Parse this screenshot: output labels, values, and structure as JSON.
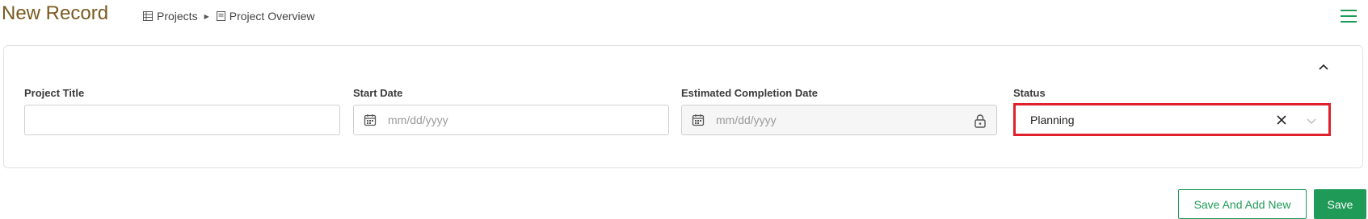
{
  "header": {
    "title": "New Record",
    "breadcrumb": [
      {
        "label": "Projects",
        "icon": "table-icon"
      },
      {
        "label": "Project Overview",
        "icon": "document-icon"
      }
    ],
    "menu_icon": "hamburger-menu-icon"
  },
  "form": {
    "collapse_icon": "chevron-up-icon",
    "fields": {
      "project_title": {
        "label": "Project Title",
        "value": "",
        "placeholder": ""
      },
      "start_date": {
        "label": "Start Date",
        "placeholder": "mm/dd/yyyy",
        "icon": "calendar-icon"
      },
      "estimated_completion": {
        "label": "Estimated Completion Date",
        "placeholder": "mm/dd/yyyy",
        "icon": "calendar-icon",
        "locked_icon": "lock-icon"
      },
      "status": {
        "label": "Status",
        "value": "Planning",
        "clear_icon": "close-icon",
        "dropdown_icon": "chevron-down-icon"
      }
    }
  },
  "actions": {
    "save_and_add_new": "Save And Add New",
    "save": "Save"
  },
  "colors": {
    "title": "#7a5a1f",
    "accent": "#1f9a57",
    "highlight": "#e0202a"
  }
}
